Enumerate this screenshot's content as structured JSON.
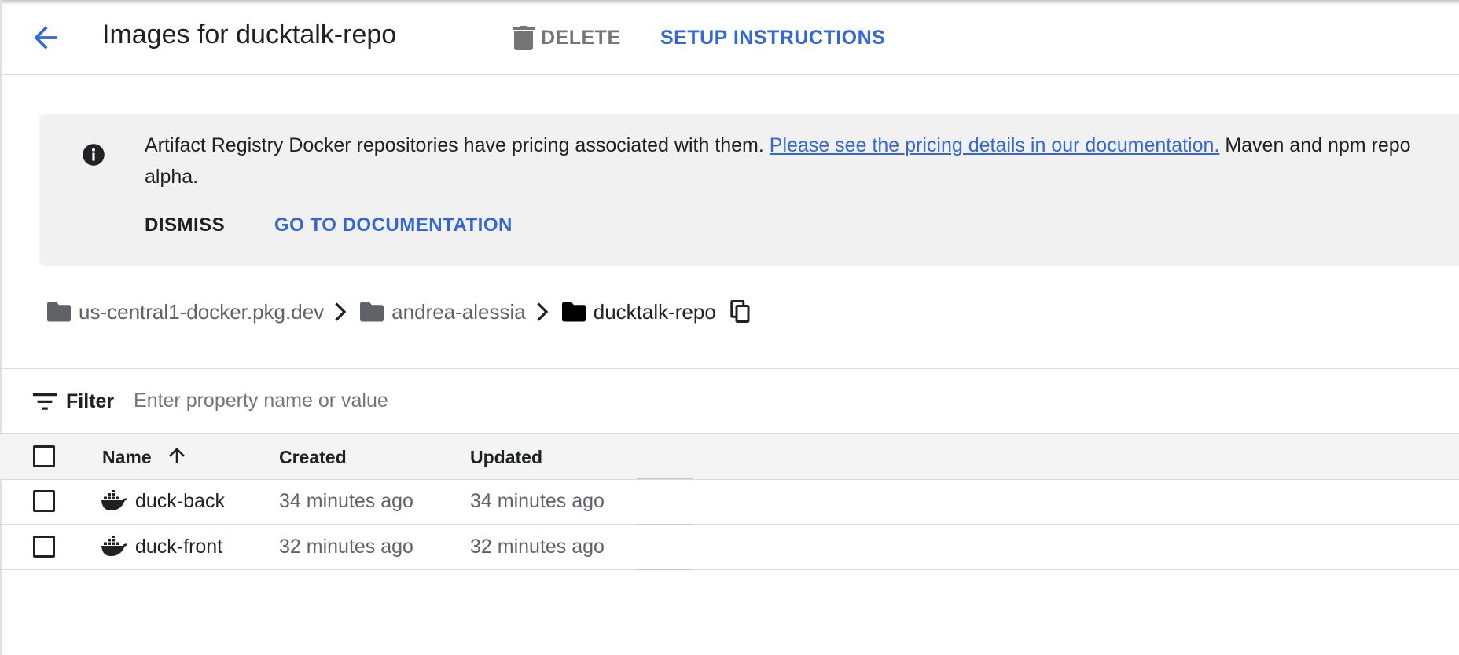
{
  "header": {
    "title": "Images for ducktalk-repo",
    "delete_label": "DELETE",
    "setup_label": "SETUP INSTRUCTIONS"
  },
  "banner": {
    "text_before": "Artifact Registry Docker repositories have pricing associated with them.",
    "link_text": "Please see the pricing details in our documentation.",
    "text_after": "Maven and npm repo",
    "text_line2": "alpha.",
    "dismiss_label": "DISMISS",
    "docs_label": "GO TO DOCUMENTATION"
  },
  "breadcrumb": {
    "items": [
      "us-central1-docker.pkg.dev",
      "andrea-alessia",
      "ducktalk-repo"
    ]
  },
  "filter": {
    "label": "Filter",
    "placeholder": "Enter property name or value"
  },
  "table": {
    "columns": [
      "Name",
      "Created",
      "Updated"
    ],
    "sort": "Name ascending",
    "rows": [
      {
        "name": "duck-back",
        "created": "34 minutes ago",
        "updated": "34 minutes ago"
      },
      {
        "name": "duck-front",
        "created": "32 minutes ago",
        "updated": "32 minutes ago"
      }
    ]
  },
  "colors": {
    "accent": "#3367d6",
    "banner_bg": "#f1f1f1",
    "header_row_bg": "#f4f4f4",
    "muted_text": "#5f6368"
  },
  "icons": [
    "arrow-back-icon",
    "trash-icon",
    "info-icon",
    "folder-icon",
    "chevron-right-icon",
    "copy-icon",
    "filter-icon",
    "arrow-up-icon",
    "docker-icon"
  ]
}
